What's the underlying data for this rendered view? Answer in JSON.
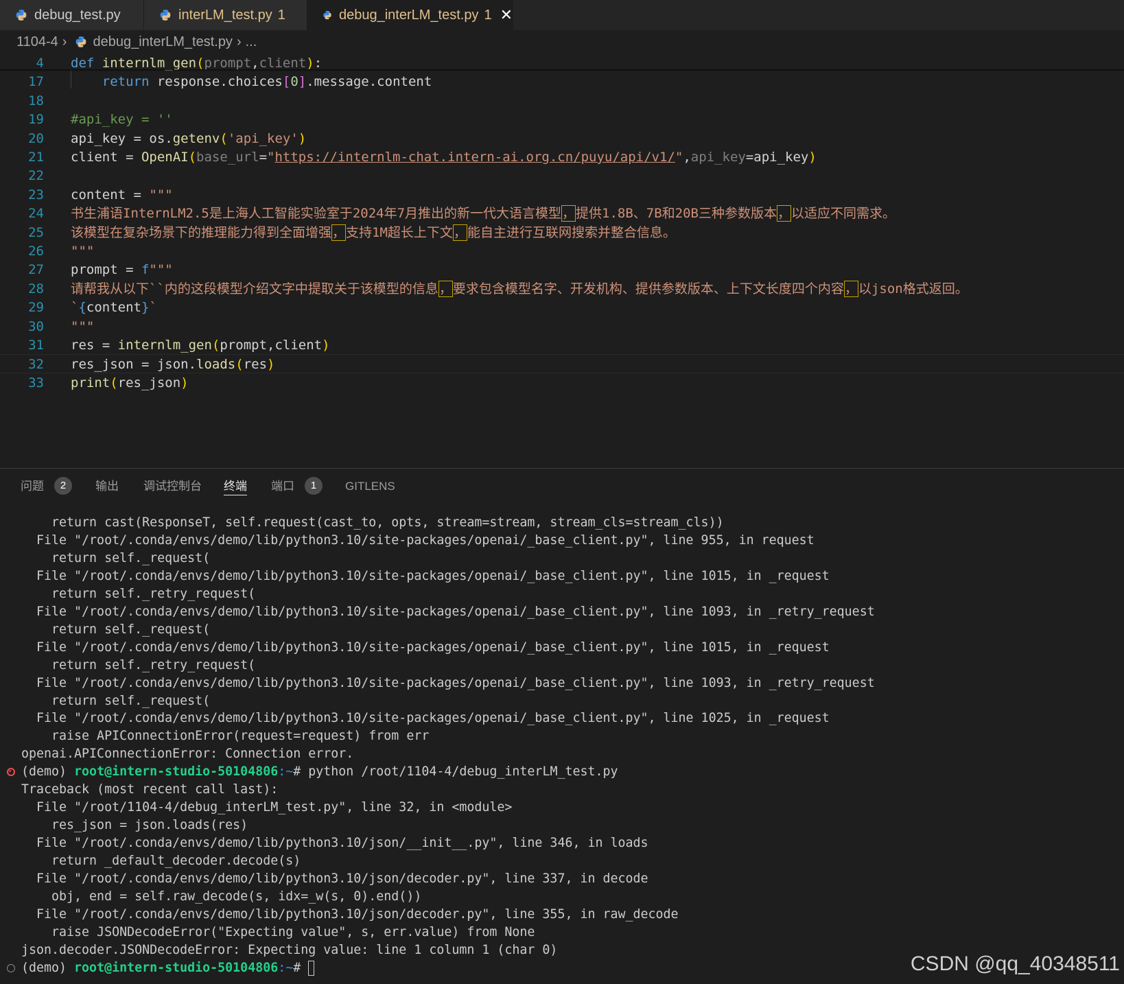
{
  "tabs": [
    {
      "label": "debug_test.py",
      "count": "",
      "color": "#9d9d9d"
    },
    {
      "label": "interLM_test.py",
      "count": "1",
      "color": "#e2c08d"
    },
    {
      "label": "debug_interLM_test.py",
      "count": "1",
      "color": "#e2c08d",
      "close": "✕"
    }
  ],
  "breadcrumb": {
    "folder": "1104-4",
    "file": "debug_interLM_test.py",
    "more": "..."
  },
  "editor": {
    "lines": [
      {
        "n": "4",
        "html": "<span class='kw'>def</span> <span class='fn'>internlm_gen</span><span class='par'>(</span><span class='prm'>prompt</span>,<span class='prm'>client</span><span class='par'>)</span>:"
      },
      {
        "n": "17",
        "html": "    <span class='kw'>return</span> response.choices<span class='br2'>[</span><span class='num'>0</span><span class='br2'>]</span>.message.content"
      },
      {
        "n": "18",
        "html": ""
      },
      {
        "n": "19",
        "html": "<span class='cm'>#api_key = ''</span>"
      },
      {
        "n": "20",
        "html": "api_key = os.<span class='fn'>getenv</span><span class='par'>(</span><span class='str'>'api_key'</span><span class='par'>)</span>"
      },
      {
        "n": "21",
        "html": "client = <span class='fn'>OpenAI</span><span class='par'>(</span><span class='prm'>base_url</span>=<span class='str'>\"</span><span class='url'>https://internlm-chat.intern-ai.org.cn/puyu/api/v1/</span><span class='str'>\"</span>,<span class='prm'>api_key</span>=api_key<span class='par'>)</span>"
      },
      {
        "n": "22",
        "html": ""
      },
      {
        "n": "23",
        "html": "content = <span class='str'>\"\"\"</span>"
      },
      {
        "n": "24",
        "html": "<span class='str'>书生浦语InternLM2.5是上海人工智能实验室于2024年7月推出的新一代大语言模型<span class='box'>，</span>提供1.8B、7B和20B三种参数版本<span class='box'>，</span>以适应不同需求。</span>"
      },
      {
        "n": "25",
        "html": "<span class='str'>该模型在复杂场景下的推理能力得到全面增强<span class='box'>，</span>支持1M超长上下文<span class='box'>，</span>能自主进行互联网搜索并整合信息。</span>"
      },
      {
        "n": "26",
        "html": "<span class='str'>\"\"\"</span>"
      },
      {
        "n": "27",
        "html": "prompt = <span class='kw'>f</span><span class='str'>\"\"\"</span>"
      },
      {
        "n": "28",
        "html": "<span class='str'>请帮我从以下``内的这段模型介绍文字中提取关于该模型的信息<span class='box'>，</span>要求包含模型名字、开发机构、提供参数版本、上下文长度四个内容<span class='box'>，</span>以json格式返回。</span>"
      },
      {
        "n": "29",
        "html": "<span class='str'>`</span><span class='kw'>{</span>content<span class='kw'>}</span><span class='str'>`</span>"
      },
      {
        "n": "30",
        "html": "<span class='str'>\"\"\"</span>"
      },
      {
        "n": "31",
        "html": "res = <span class='fn'>internlm_gen</span><span class='par'>(</span>prompt,client<span class='par'>)</span>"
      },
      {
        "n": "32",
        "html": "res_json = json.<span class='fn'>loads</span><span class='par'>(</span>res<span class='par'>)</span>"
      },
      {
        "n": "33",
        "html": "<span class='fn'>print</span><span class='par'>(</span>res_json<span class='par'>)</span>"
      }
    ]
  },
  "panel": {
    "tabs": [
      {
        "label": "问题",
        "badge": "2"
      },
      {
        "label": "输出",
        "badge": ""
      },
      {
        "label": "调试控制台",
        "badge": ""
      },
      {
        "label": "终端",
        "badge": "",
        "active": true
      },
      {
        "label": "端口",
        "badge": "1"
      },
      {
        "label": "GITLENS",
        "badge": ""
      }
    ]
  },
  "terminal": {
    "lines": [
      "    return cast(ResponseT, self.request(cast_to, opts, stream=stream, stream_cls=stream_cls))",
      "  File \"/root/.conda/envs/demo/lib/python3.10/site-packages/openai/_base_client.py\", line 955, in request",
      "    return self._request(",
      "  File \"/root/.conda/envs/demo/lib/python3.10/site-packages/openai/_base_client.py\", line 1015, in _request",
      "    return self._retry_request(",
      "  File \"/root/.conda/envs/demo/lib/python3.10/site-packages/openai/_base_client.py\", line 1093, in _retry_request",
      "    return self._request(",
      "  File \"/root/.conda/envs/demo/lib/python3.10/site-packages/openai/_base_client.py\", line 1015, in _request",
      "    return self._retry_request(",
      "  File \"/root/.conda/envs/demo/lib/python3.10/site-packages/openai/_base_client.py\", line 1093, in _retry_request",
      "    return self._request(",
      "  File \"/root/.conda/envs/demo/lib/python3.10/site-packages/openai/_base_client.py\", line 1025, in _request",
      "    raise APIConnectionError(request=request) from err",
      "openai.APIConnectionError: Connection error.",
      "",
      "Traceback (most recent call last):",
      "  File \"/root/1104-4/debug_interLM_test.py\", line 32, in <module>",
      "    res_json = json.loads(res)",
      "  File \"/root/.conda/envs/demo/lib/python3.10/json/__init__.py\", line 346, in loads",
      "    return _default_decoder.decode(s)",
      "  File \"/root/.conda/envs/demo/lib/python3.10/json/decoder.py\", line 337, in decode",
      "    obj, end = self.raw_decode(s, idx=_w(s, 0).end())",
      "  File \"/root/.conda/envs/demo/lib/python3.10/json/decoder.py\", line 355, in raw_decode",
      "    raise JSONDecodeError(\"Expecting value\", s, err.value) from None",
      "json.decoder.JSONDecodeError: Expecting value: line 1 column 1 (char 0)",
      ""
    ],
    "prompt1": {
      "env": "(demo) ",
      "user": "root@intern-studio-50104806",
      "path": ":~",
      "sym": "# ",
      "cmd": "python /root/1104-4/debug_interLM_test.py"
    },
    "prompt2": {
      "env": "(demo) ",
      "user": "root@intern-studio-50104806",
      "path": ":~",
      "sym": "# ",
      "cmd": ""
    }
  },
  "watermark": "CSDN @qq_40348511",
  "colors": {
    "error": "#f14c4c",
    "ok": "#888888",
    "tab_modified": "#e2c08d"
  }
}
